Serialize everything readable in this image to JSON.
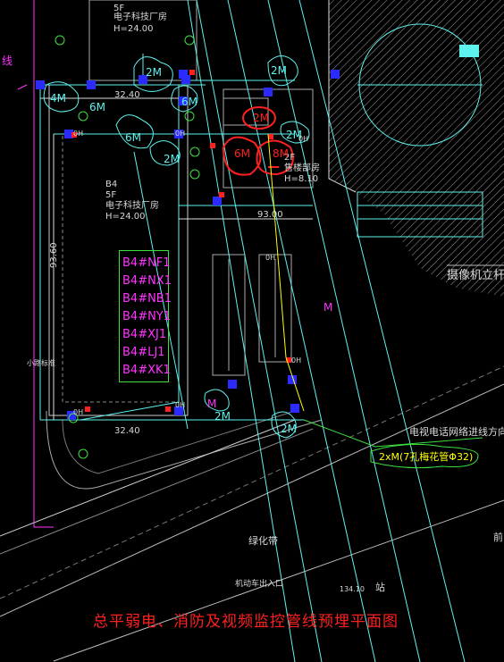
{
  "title": "总平弱电、消防及视频监控管线预埋平面图",
  "top_building": {
    "floors": "5F",
    "name": "电子科技厂房",
    "height": "H=24.00"
  },
  "main_building": {
    "floors": "5F",
    "name": "电子科技厂房",
    "height": "H=24.00",
    "code": "B4"
  },
  "small_building": {
    "floors": "2F",
    "name": "售楼部房",
    "height": "H=8.10"
  },
  "dims": {
    "d1": "32.40",
    "d2": "32.40",
    "d3": "93.00",
    "d4": "93.60"
  },
  "codes": [
    "B4#NF1",
    "B4#NX1",
    "B4#NB1",
    "B4#NY1",
    "B4#XJ1",
    "B4#LJ1",
    "B4#XK1"
  ],
  "pipe_labels": {
    "m2_top": "2M",
    "m2_right": "2M",
    "m4_left": "4M",
    "m6_a": "6M",
    "m6_b": "6M",
    "m6_left": "6M",
    "m2_mid": "2M",
    "m2_red": "2M",
    "m2_b": "2M",
    "m6_red": "6M",
    "m8_red": "8M",
    "m_low": "M",
    "m2_low": "2M",
    "m2_bottom": "2M",
    "m_right": "M"
  },
  "side_labels": {
    "left_text": "线",
    "small_road": "小路标准"
  },
  "oh_labels": [
    "0H",
    "0H",
    "0H",
    "0H",
    "0H",
    "0H",
    "0H"
  ],
  "right_text": "摄像机立杆防",
  "cable_direction": "电视电话网络进线方向",
  "cable_spec": "2xM(7孔梅花管Φ32)",
  "green_belt": "绿化带",
  "vehicle_entrance": "机动车出入口",
  "road_label_a": "134.10",
  "road_label_b": "站",
  "edge_char": "前",
  "colors": {
    "cyan": "#5ef2ee",
    "magenta": "#ff33ff",
    "red": "#ff2020",
    "green": "#3ee03e",
    "yellow": "#ffff00",
    "blue": "#2b2bff"
  }
}
